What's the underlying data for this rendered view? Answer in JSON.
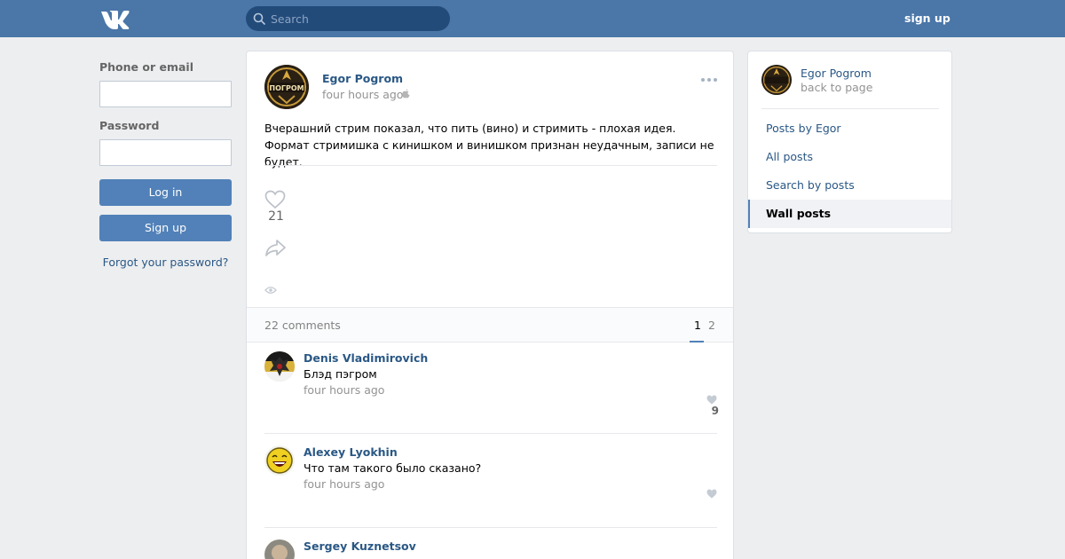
{
  "header": {
    "search_placeholder": "Search",
    "signup_label": "sign up"
  },
  "login": {
    "phone_label": "Phone or email",
    "phone_value": "",
    "password_label": "Password",
    "password_value": "",
    "login_button": "Log in",
    "signup_button": "Sign up",
    "forgot_link": "Forgot your password?"
  },
  "post": {
    "author": "Egor Pogrom",
    "avatar_text": "ПОГРОМ",
    "time": "four hours ago",
    "text": "Вчерашний стрим показал, что пить (вино) и стримить - плохая идея. Формат стримишка с кинишком и винишком признан неудачным, записи не будет.",
    "likes": "21",
    "comments_count": "22 comments",
    "pages": [
      "1",
      "2"
    ]
  },
  "comments": [
    {
      "author": "Denis Vladimirovich",
      "text": "Блэд пэгром",
      "time": "four hours ago",
      "likes": "9"
    },
    {
      "author": "Alexey Lyokhin",
      "text": "Что там такого было сказано?",
      "time": "four hours ago",
      "likes": ""
    },
    {
      "author": "Sergey Kuznetsov",
      "text": "",
      "time": "",
      "likes": ""
    }
  ],
  "sidebar": {
    "name": "Egor Pogrom",
    "back": "back to page",
    "items": [
      {
        "label": "Posts by Egor",
        "active": false
      },
      {
        "label": "All posts",
        "active": false
      },
      {
        "label": "Search by posts",
        "active": false
      },
      {
        "label": "Wall posts",
        "active": true
      }
    ]
  },
  "colors": {
    "header": "#4a76a8",
    "link": "#2a5885",
    "button": "#5181b8",
    "background": "#edeef0"
  }
}
